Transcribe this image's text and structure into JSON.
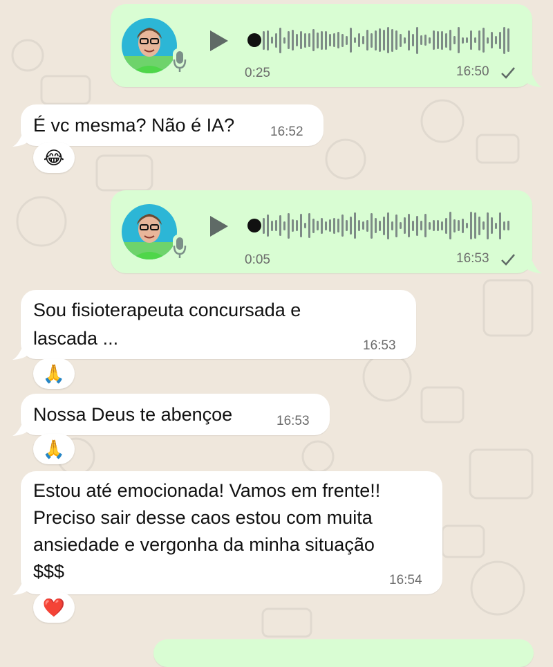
{
  "messages": [
    {
      "id": "v1",
      "type": "voice",
      "direction": "out",
      "duration": "0:25",
      "time": "16:50",
      "status": "sent"
    },
    {
      "id": "m1",
      "type": "text",
      "direction": "in",
      "text": "É vc mesma? Não é IA?",
      "time": "16:52",
      "reaction": "😂"
    },
    {
      "id": "v2",
      "type": "voice",
      "direction": "out",
      "duration": "0:05",
      "time": "16:53",
      "status": "sent"
    },
    {
      "id": "m2",
      "type": "text",
      "direction": "in",
      "lines": [
        "Sou fisioterapeuta concursada e",
        "lascada ..."
      ],
      "time": "16:53",
      "reaction": "🙏"
    },
    {
      "id": "m3",
      "type": "text",
      "direction": "in",
      "text": "Nossa Deus te abençoe",
      "time": "16:53",
      "reaction": "🙏"
    },
    {
      "id": "m4",
      "type": "text",
      "direction": "in",
      "lines": [
        "Estou até emocionada! Vamos em frente!!",
        "Preciso sair desse caos estou com muita",
        "ansiedade e vergonha da minha situação",
        "$$$"
      ],
      "time": "16:54",
      "reaction": "❤️"
    }
  ],
  "icons": {
    "play": "play-icon",
    "mic": "microphone-icon",
    "tick": "single-check-icon"
  },
  "colors": {
    "background": "#efe7dc",
    "incoming": "#ffffff",
    "outgoing": "#d9fdd3",
    "waveform": "#7d8a86",
    "mic": "#7b8f88"
  }
}
